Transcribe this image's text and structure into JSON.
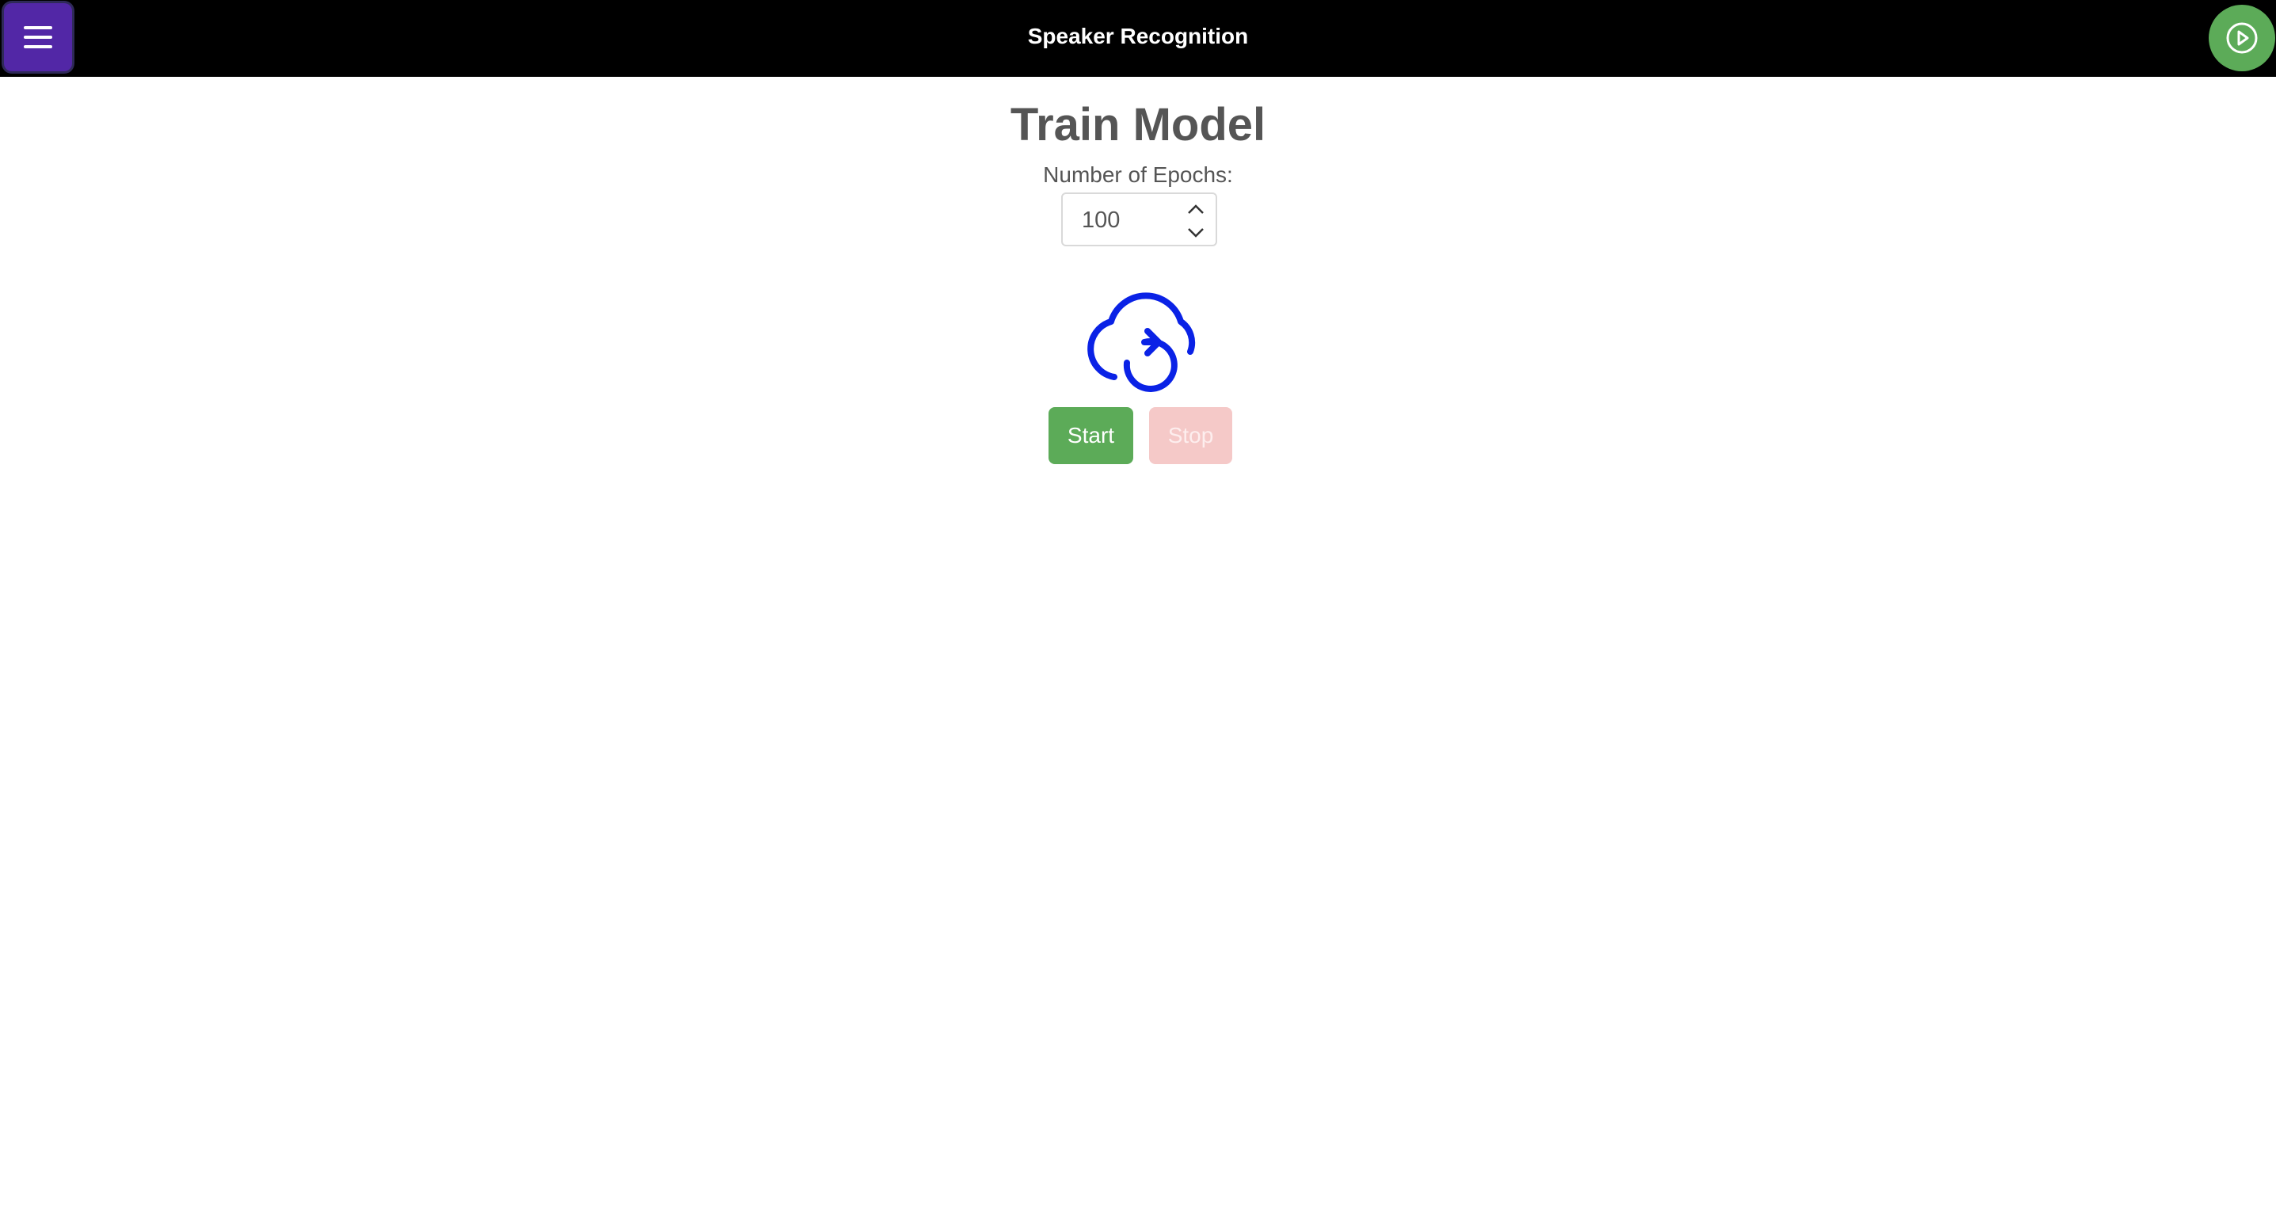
{
  "header": {
    "app_title": "Speaker Recognition",
    "menu_icon": "hamburger-menu-icon",
    "play_icon": "play-circle-icon",
    "menu_color": "#5227a6",
    "play_color": "#5cab58"
  },
  "main": {
    "title": "Train Model",
    "epochs_label": "Number of Epochs:",
    "epochs_value": "100",
    "train_icon": "cloud-sync-icon",
    "train_icon_color": "#0a22e6",
    "start_label": "Start",
    "stop_label": "Stop",
    "start_color": "#5cab58",
    "stop_color": "#f5c9c8",
    "stop_disabled": true
  }
}
